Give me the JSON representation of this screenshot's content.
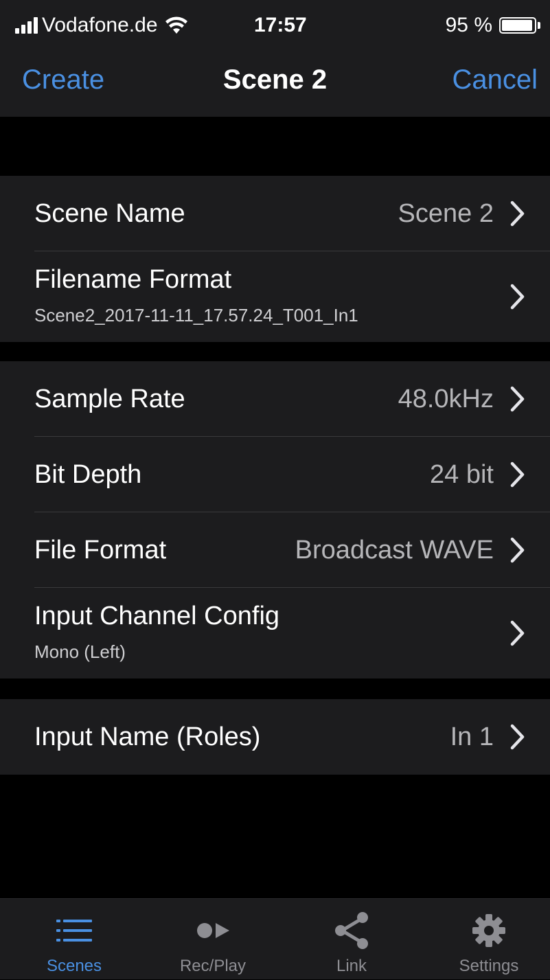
{
  "status_bar": {
    "carrier": "Vodafone.de",
    "time": "17:57",
    "battery": "95 %",
    "battery_level": 0.95
  },
  "nav": {
    "left_button": "Create",
    "title": "Scene 2",
    "right_button": "Cancel"
  },
  "rows": {
    "scene_name": {
      "label": "Scene Name",
      "value": "Scene 2"
    },
    "filename_format": {
      "label": "Filename Format",
      "sublabel": "Scene2_2017-11-11_17.57.24_T001_In1"
    },
    "sample_rate": {
      "label": "Sample Rate",
      "value": "48.0kHz"
    },
    "bit_depth": {
      "label": "Bit Depth",
      "value": "24 bit"
    },
    "file_format": {
      "label": "File Format",
      "value": "Broadcast WAVE"
    },
    "input_channel_config": {
      "label": "Input Channel Config",
      "sublabel": "Mono (Left)"
    },
    "input_name": {
      "label": "Input Name (Roles)",
      "value": "In 1"
    }
  },
  "tabs": [
    {
      "label": "Scenes",
      "icon": "list-icon",
      "active": true
    },
    {
      "label": "Rec/Play",
      "icon": "record-play-icon",
      "active": false
    },
    {
      "label": "Link",
      "icon": "share-icon",
      "active": false
    },
    {
      "label": "Settings",
      "icon": "gear-icon",
      "active": false
    }
  ],
  "colors": {
    "accent": "#4a90e2",
    "background": "#000000",
    "cell": "#1c1c1e",
    "inactive_tab": "#8e8e93"
  }
}
